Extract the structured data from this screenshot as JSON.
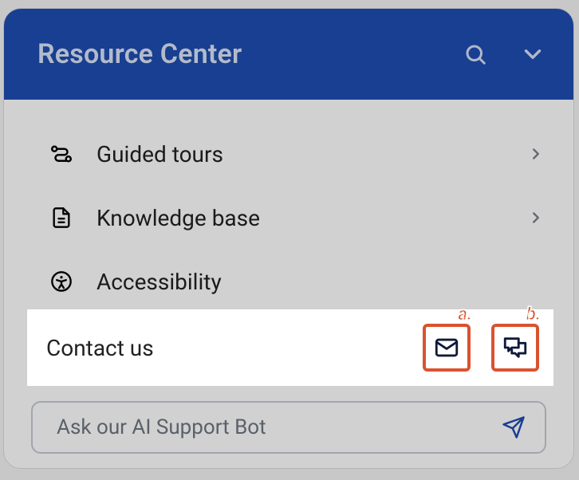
{
  "header": {
    "title": "Resource Center"
  },
  "menu": {
    "items": [
      {
        "label": "Guided tours"
      },
      {
        "label": "Knowledge base"
      },
      {
        "label": "Accessibility"
      }
    ]
  },
  "contact": {
    "label": "Contact us",
    "callouts": {
      "email": "a.",
      "chat": "b."
    }
  },
  "bot": {
    "placeholder": "Ask our AI Support Bot"
  },
  "colors": {
    "header_bg": "#1f4db3",
    "callout_border": "#d9532f"
  }
}
